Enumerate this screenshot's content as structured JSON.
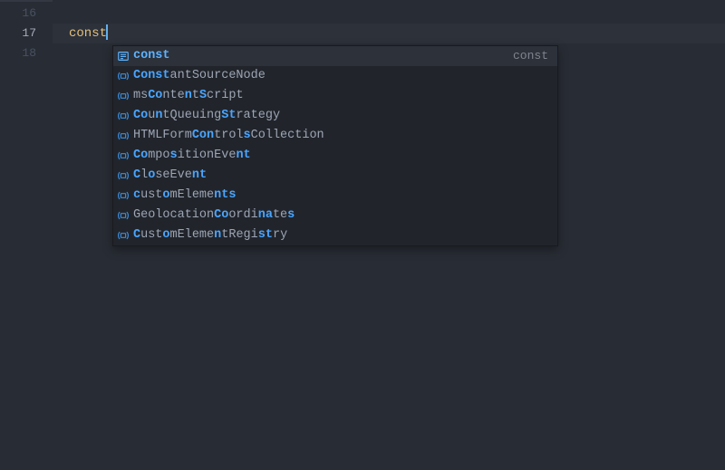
{
  "colors": {
    "bg": "#282c34",
    "accent": "#61afef",
    "match": "#4aa5ff"
  },
  "gutter": {
    "lines": [
      {
        "n": "16",
        "current": false
      },
      {
        "n": "17",
        "current": true
      },
      {
        "n": "18",
        "current": false
      }
    ]
  },
  "code": {
    "lines": [
      {
        "text": "",
        "current": false
      },
      {
        "text": "const",
        "current": true,
        "token": "keyword",
        "cursor_after": true
      },
      {
        "text": "",
        "current": false
      }
    ]
  },
  "suggest": {
    "visible": true,
    "selected_index": 0,
    "items": [
      {
        "icon": "keyword-icon",
        "segments": [
          {
            "t": "const",
            "m": true
          }
        ],
        "detail": "const"
      },
      {
        "icon": "variable-icon",
        "segments": [
          {
            "t": "Const",
            "m": true
          },
          {
            "t": "antSourceNode",
            "m": false
          }
        ],
        "detail": ""
      },
      {
        "icon": "variable-icon",
        "segments": [
          {
            "t": "ms",
            "m": false
          },
          {
            "t": "Co",
            "m": true
          },
          {
            "t": "nte",
            "m": false
          },
          {
            "t": "n",
            "m": true
          },
          {
            "t": "t",
            "m": false
          },
          {
            "t": "S",
            "m": true
          },
          {
            "t": "cript",
            "m": false
          }
        ],
        "detail": ""
      },
      {
        "icon": "variable-icon",
        "segments": [
          {
            "t": "Co",
            "m": true
          },
          {
            "t": "u",
            "m": false
          },
          {
            "t": "n",
            "m": true
          },
          {
            "t": "tQueuing",
            "m": false
          },
          {
            "t": "St",
            "m": true
          },
          {
            "t": "rategy",
            "m": false
          }
        ],
        "detail": ""
      },
      {
        "icon": "variable-icon",
        "segments": [
          {
            "t": "HTMLForm",
            "m": false
          },
          {
            "t": "Con",
            "m": true
          },
          {
            "t": "trol",
            "m": false
          },
          {
            "t": "s",
            "m": true
          },
          {
            "t": "Collection",
            "m": false
          }
        ],
        "detail": ""
      },
      {
        "icon": "variable-icon",
        "segments": [
          {
            "t": "Co",
            "m": true
          },
          {
            "t": "mpo",
            "m": false
          },
          {
            "t": "s",
            "m": true
          },
          {
            "t": "itionEve",
            "m": false
          },
          {
            "t": "nt",
            "m": true
          }
        ],
        "detail": ""
      },
      {
        "icon": "variable-icon",
        "segments": [
          {
            "t": "C",
            "m": true
          },
          {
            "t": "l",
            "m": false
          },
          {
            "t": "o",
            "m": true
          },
          {
            "t": "seEve",
            "m": false
          },
          {
            "t": "nt",
            "m": true
          }
        ],
        "detail": ""
      },
      {
        "icon": "variable-icon",
        "segments": [
          {
            "t": "c",
            "m": true
          },
          {
            "t": "ust",
            "m": false
          },
          {
            "t": "o",
            "m": true
          },
          {
            "t": "mEleme",
            "m": false
          },
          {
            "t": "nts",
            "m": true
          }
        ],
        "detail": ""
      },
      {
        "icon": "variable-icon",
        "segments": [
          {
            "t": "Geolocation",
            "m": false
          },
          {
            "t": "Co",
            "m": true
          },
          {
            "t": "ordi",
            "m": false
          },
          {
            "t": "na",
            "m": true
          },
          {
            "t": "te",
            "m": false
          },
          {
            "t": "s",
            "m": true
          }
        ],
        "detail": ""
      },
      {
        "icon": "variable-icon",
        "segments": [
          {
            "t": "C",
            "m": true
          },
          {
            "t": "ust",
            "m": false
          },
          {
            "t": "o",
            "m": true
          },
          {
            "t": "mEleme",
            "m": false
          },
          {
            "t": "n",
            "m": true
          },
          {
            "t": "tRegi",
            "m": false
          },
          {
            "t": "st",
            "m": true
          },
          {
            "t": "ry",
            "m": false
          }
        ],
        "detail": ""
      }
    ]
  }
}
